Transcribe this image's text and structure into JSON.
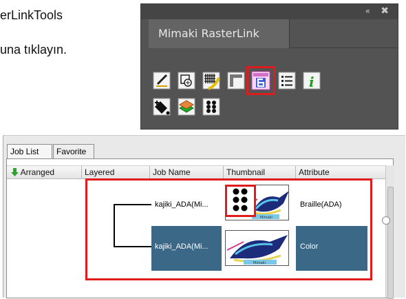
{
  "doc": {
    "line1": "erLinkTools",
    "line2": "una tıklayın."
  },
  "panel": {
    "tab_title": "Mimaki RasterLink",
    "collapse_icon": "«",
    "close_icon": "✖",
    "tools": [
      "pen-tool-icon",
      "cut-path-icon",
      "grid-fill-icon",
      "frame-icon",
      "rasterlink6-icon",
      "job-list-icon",
      "info-icon",
      "fill-icon",
      "layers-icon",
      "braille-dots-icon"
    ]
  },
  "rasterlink": {
    "tabs": [
      "Job List",
      "Favorite"
    ],
    "columns": [
      "Arranged",
      "Layered",
      "Job Name",
      "Thumbnail",
      "Attribute"
    ],
    "jobs": [
      {
        "name": "kajiki_ADA(Mi...",
        "attribute": "Braille(ADA)",
        "selected": false
      },
      {
        "name": "kajiki_ADA(Mi...",
        "attribute": "Color",
        "selected": true
      }
    ],
    "selection_color": "#3c6888",
    "highlight_color": "#e01b1b"
  }
}
